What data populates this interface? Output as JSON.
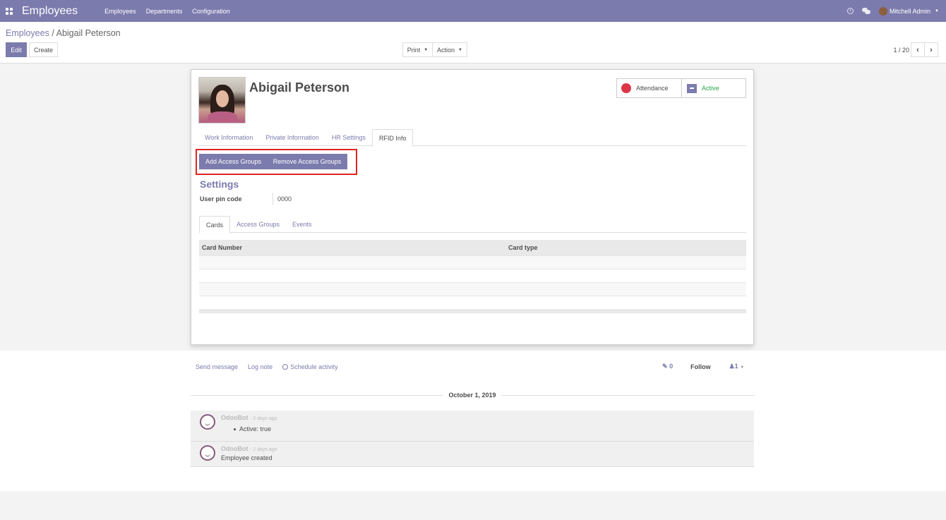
{
  "navbar": {
    "app_title": "Employees",
    "menu": [
      "Employees",
      "Departments",
      "Configuration"
    ],
    "user_name": "Mitchell Admin"
  },
  "control_panel": {
    "breadcrumb_parent": "Employees",
    "breadcrumb_separator": "/",
    "breadcrumb_current": "Abigail Peterson",
    "edit_label": "Edit",
    "create_label": "Create",
    "print_label": "Print",
    "action_label": "Action",
    "pager": "1 / 20",
    "prev_icon": "chevron-left-icon",
    "next_icon": "chevron-right-icon",
    "prev_glyph": "‹",
    "next_glyph": "›"
  },
  "form": {
    "employee_name": "Abigail Peterson",
    "attendance_label": "Attendance",
    "active_label": "Active",
    "tabs": [
      "Work Information",
      "Private Information",
      "HR Settings",
      "RFID Info"
    ],
    "active_tab": "RFID Info",
    "add_access_groups_label": "Add Access Groups",
    "remove_access_groups_label": "Remove Access Groups",
    "settings_title": "Settings",
    "pin_label": "User pin code",
    "pin_value": "0000",
    "subtabs": [
      "Cards",
      "Access Groups",
      "Events"
    ],
    "active_subtab": "Cards",
    "table_headers": [
      "Card Number",
      "Card type"
    ],
    "table_rows": []
  },
  "chatter": {
    "send_message": "Send message",
    "log_note": "Log note",
    "schedule_activity": "Schedule activity",
    "attachments_count": "0",
    "follow_label": "Follow",
    "followers_count": "1",
    "date_separator": "October 1, 2019",
    "messages": [
      {
        "author": "OdooBot",
        "time": "- 2 days ago",
        "body": "Active: true"
      },
      {
        "author": "OdooBot",
        "time": "- 2 days ago",
        "body": "Employee created"
      }
    ]
  },
  "colors": {
    "brand": "#7c7bad",
    "highlight_border": "#e02424",
    "attendance_dot": "#dc3545",
    "active_text": "#28a745"
  }
}
